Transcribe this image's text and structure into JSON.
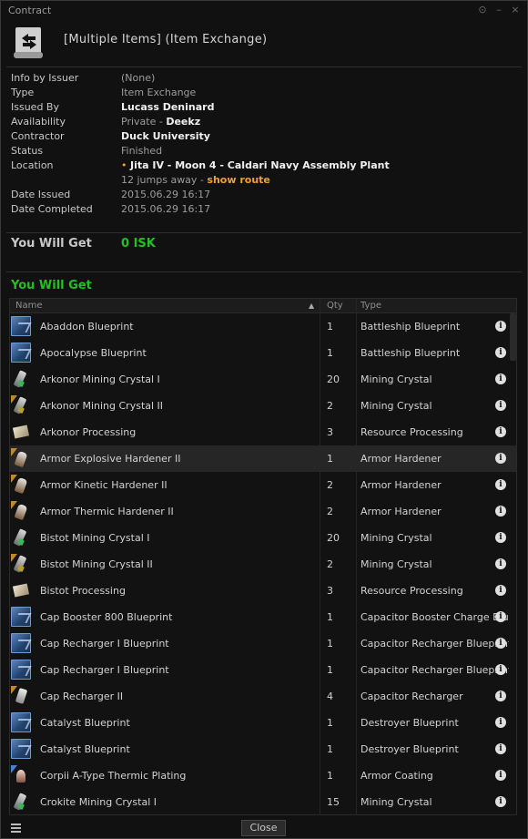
{
  "window": {
    "title": "Contract"
  },
  "header": {
    "heading": "[Multiple Items] (Item Exchange)"
  },
  "info": [
    {
      "key": "Info by Issuer",
      "value": "(None)"
    },
    {
      "key": "Type",
      "value": "Item Exchange"
    },
    {
      "key": "Issued By",
      "value": "Lucass Deninard"
    },
    {
      "key": "Availability",
      "value": "Private",
      "extra": "Deekz"
    },
    {
      "key": "Contractor",
      "value": "Duck University"
    },
    {
      "key": "Status",
      "value": "Finished"
    },
    {
      "key": "Location",
      "value": "Jita IV - Moon 4 - Caldari Navy Assembly Plant",
      "jumps": "12 jumps away -",
      "route_link": "show route"
    },
    {
      "key": "Date Issued",
      "value": "2015.06.29 16:17"
    },
    {
      "key": "Date Completed",
      "value": "2015.06.29 16:17"
    }
  ],
  "you_will_get_isk": {
    "label": "You Will Get",
    "value": "0 ISK"
  },
  "you_will_get_items": {
    "label": "You Will Get"
  },
  "table": {
    "columns": [
      "Name",
      "Qty",
      "Type"
    ],
    "rows": [
      {
        "name": "Abaddon Blueprint",
        "qty": "1",
        "type": "Battleship Blueprint",
        "icon": "blueprint-icon"
      },
      {
        "name": "Apocalypse Blueprint",
        "qty": "1",
        "type": "Battleship Blueprint",
        "icon": "blueprint-icon"
      },
      {
        "name": "Arkonor Mining Crystal I",
        "qty": "20",
        "type": "Mining Crystal",
        "icon": "mining-crystal-icon"
      },
      {
        "name": "Arkonor Mining Crystal II",
        "qty": "2",
        "type": "Mining Crystal",
        "icon": "mining-crystal-t2-icon"
      },
      {
        "name": "Arkonor Processing",
        "qty": "3",
        "type": "Resource Processing",
        "icon": "skillbook-icon"
      },
      {
        "name": "Armor Explosive Hardener II",
        "qty": "1",
        "type": "Armor Hardener",
        "icon": "armor-hardener-t2-icon",
        "highlight": true
      },
      {
        "name": "Armor Kinetic Hardener II",
        "qty": "2",
        "type": "Armor Hardener",
        "icon": "armor-hardener-t2-icon"
      },
      {
        "name": "Armor Thermic Hardener II",
        "qty": "2",
        "type": "Armor Hardener",
        "icon": "armor-hardener-t2-icon"
      },
      {
        "name": "Bistot Mining Crystal I",
        "qty": "20",
        "type": "Mining Crystal",
        "icon": "mining-crystal-icon"
      },
      {
        "name": "Bistot Mining Crystal II",
        "qty": "2",
        "type": "Mining Crystal",
        "icon": "mining-crystal-t2-icon"
      },
      {
        "name": "Bistot Processing",
        "qty": "3",
        "type": "Resource Processing",
        "icon": "skillbook-icon"
      },
      {
        "name": "Cap Booster 800 Blueprint",
        "qty": "1",
        "type": "Capacitor Booster Charge Blueprint",
        "icon": "blueprint-icon"
      },
      {
        "name": "Cap Recharger I Blueprint",
        "qty": "1",
        "type": "Capacitor Recharger Blueprint",
        "icon": "blueprint-icon"
      },
      {
        "name": "Cap Recharger I Blueprint",
        "qty": "1",
        "type": "Capacitor Recharger Blueprint",
        "icon": "blueprint-icon"
      },
      {
        "name": "Cap Recharger II",
        "qty": "4",
        "type": "Capacitor Recharger",
        "icon": "cap-recharger-t2-icon"
      },
      {
        "name": "Catalyst Blueprint",
        "qty": "1",
        "type": "Destroyer Blueprint",
        "icon": "blueprint-icon"
      },
      {
        "name": "Catalyst Blueprint",
        "qty": "1",
        "type": "Destroyer Blueprint",
        "icon": "blueprint-icon"
      },
      {
        "name": "Corpii A-Type Thermic Plating",
        "qty": "1",
        "type": "Armor Coating",
        "icon": "armor-coating-faction-icon"
      },
      {
        "name": "Crokite Mining Crystal I",
        "qty": "15",
        "type": "Mining Crystal",
        "icon": "mining-crystal-icon"
      }
    ]
  },
  "footer": {
    "close_label": "Close"
  }
}
